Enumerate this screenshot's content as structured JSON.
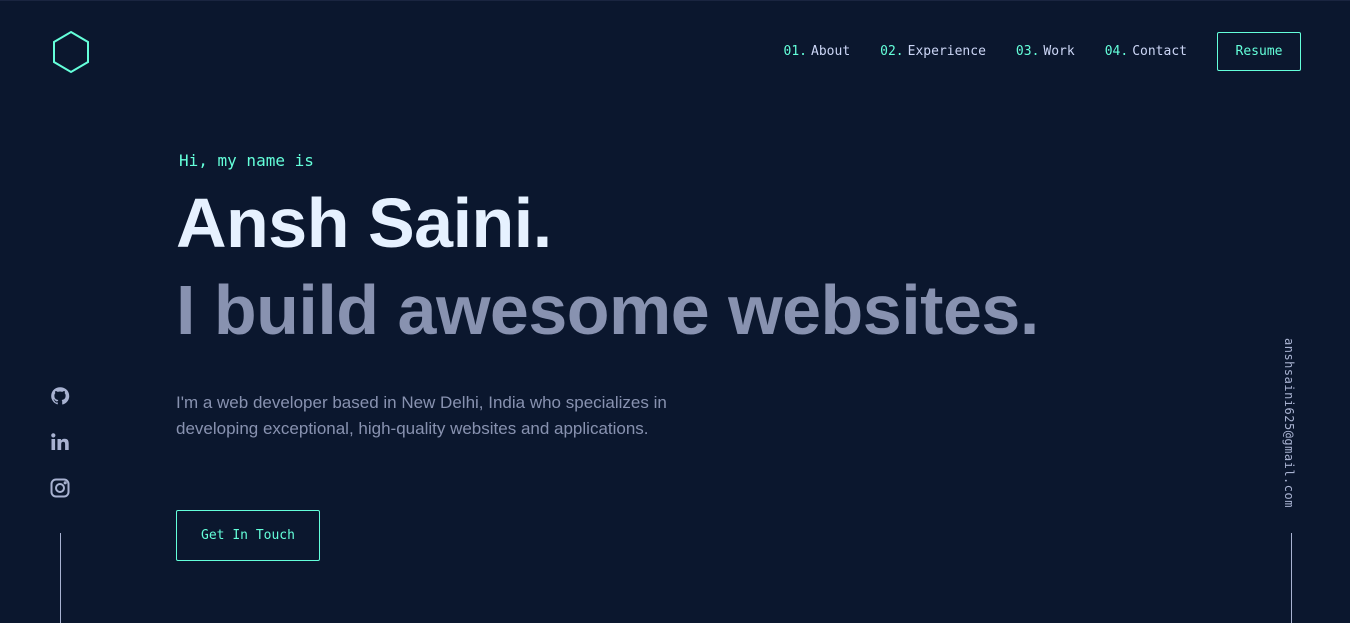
{
  "nav": {
    "items": [
      {
        "num": "01.",
        "label": "About"
      },
      {
        "num": "02.",
        "label": "Experience"
      },
      {
        "num": "03.",
        "label": "Work"
      },
      {
        "num": "04.",
        "label": "Contact"
      }
    ],
    "resume_label": "Resume"
  },
  "hero": {
    "greeting": "Hi, my name is",
    "name": "Ansh Saini.",
    "tagline": "I build awesome websites.",
    "bio": "I'm a web developer based in New Delhi, India who specializes in developing exceptional, high-quality websites and applications.",
    "cta_label": "Get In Touch"
  },
  "socials": [
    {
      "icon": "github-icon"
    },
    {
      "icon": "linkedin-icon"
    },
    {
      "icon": "instagram-icon"
    }
  ],
  "email": "anshsaini625@gmail.com",
  "colors": {
    "background": "#0b172e",
    "accent": "#64ffda",
    "heading": "#e6f1ff",
    "muted": "#8892b0"
  }
}
